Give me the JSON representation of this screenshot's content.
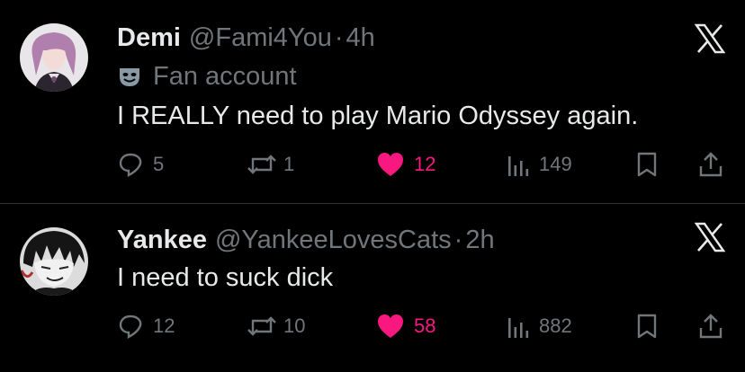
{
  "tweets": [
    {
      "name": "Demi",
      "handle": "@Fami4You",
      "separator": "·",
      "time": "4h",
      "label": "Fan account",
      "text": "I REALLY need to play Mario Odyssey again.",
      "replies": "5",
      "reposts": "1",
      "likes": "12",
      "views": "149",
      "liked": true
    },
    {
      "name": "Yankee",
      "handle": "@YankeeLovesCats",
      "separator": "·",
      "time": "2h",
      "text": "I need to suck dick",
      "replies": "12",
      "reposts": "10",
      "likes": "58",
      "views": "882",
      "liked": true
    }
  ],
  "colors": {
    "background": "#000000",
    "text": "#e7e9ea",
    "muted": "#71767b",
    "like": "#f91880",
    "divider": "#2f3336"
  }
}
